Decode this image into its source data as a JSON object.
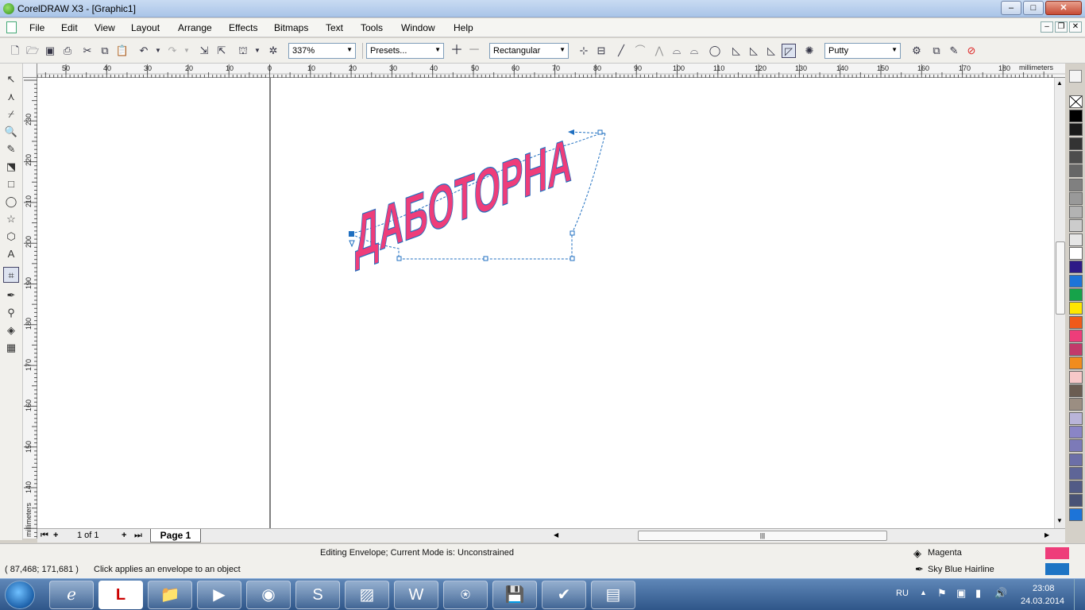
{
  "window": {
    "title": "CorelDRAW X3 - [Graphic1]",
    "controls": {
      "minimize": "–",
      "maximize": "□",
      "close": "✕"
    }
  },
  "menu": {
    "items": [
      "File",
      "Edit",
      "View",
      "Layout",
      "Arrange",
      "Effects",
      "Bitmaps",
      "Text",
      "Tools",
      "Window",
      "Help"
    ],
    "doc_controls": {
      "minimize": "–",
      "restore": "❐",
      "close": "✕"
    }
  },
  "toolbar": {
    "zoom": "337%",
    "presets": "Presets...",
    "mapping_mode": "Rectangular",
    "envelope_mode": "Putty"
  },
  "ruler": {
    "unit_h": "millimeters",
    "unit_v": "millimeters",
    "h_ticks": [
      "50",
      "40",
      "30",
      "20",
      "10",
      "0",
      "10",
      "20",
      "30",
      "40",
      "50",
      "60",
      "70",
      "80",
      "90",
      "100",
      "110",
      "120",
      "130",
      "140",
      "150",
      "160",
      "170",
      "180"
    ],
    "v_ticks": [
      "230",
      "220",
      "210",
      "200",
      "190",
      "180",
      "170",
      "160",
      "150",
      "140"
    ]
  },
  "artwork": {
    "text": "ДАБОТОРНА",
    "fill_color": "#ee3d7a",
    "outline_color": "#1f6fc0"
  },
  "palette": {
    "colors": [
      "#000000",
      "#1a1a1a",
      "#333333",
      "#4d4d4d",
      "#666666",
      "#808080",
      "#999999",
      "#b3b3b3",
      "#cccccc",
      "#e6e6e6",
      "#ffffff",
      "#2e1a87",
      "#1d74d8",
      "#16a34a",
      "#ffe600",
      "#f05a1a",
      "#ee3d7a",
      "#c23a6a",
      "#f08c1e",
      "#f7c8c8",
      "#6b5d52",
      "#9b8e82",
      "#b9b4d9",
      "#8a85c6",
      "#7c7ab8",
      "#6c6fa8",
      "#5e6597",
      "#525b86",
      "#495275",
      "#1d74d8"
    ]
  },
  "pages": {
    "counter": "1 of 1",
    "tab": "Page 1"
  },
  "status": {
    "mode": "Editing Envelope;  Current Mode is: Unconstrained",
    "coords": "( 87,468; 171,681 )",
    "hint": "Click applies an envelope to an object",
    "fill_name": "Magenta",
    "fill_color": "#ee3d7a",
    "outline_name": "Sky Blue  Hairline",
    "outline_color": "#1d74c4"
  },
  "taskbar": {
    "lang": "RU",
    "time": "23:08",
    "date": "24.03.2014"
  }
}
